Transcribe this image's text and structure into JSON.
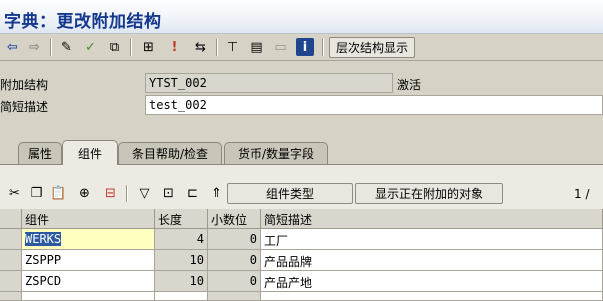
{
  "window": {
    "title": "字典：更改附加结构"
  },
  "toolbar": {
    "icons": [
      "back-arrow-icon",
      "forward-arrow-icon",
      "pencil-glasses-icon",
      "check-icon",
      "activate-icon",
      "where-used-icon",
      "info-exclaim-icon",
      "navigate-icon",
      "hierarchy-icon",
      "print-layout-icon",
      "empty-icon",
      "info-icon"
    ],
    "hierarchy_button": "层次结构显示"
  },
  "header": {
    "append_structure_label": "附加结构",
    "append_structure_value": "YTST_002",
    "status": "激活",
    "short_desc_label": "简短描述",
    "short_desc_value": "test_002"
  },
  "tabs": [
    "属性",
    "组件",
    "条目帮助/检查",
    "货币/数量字段"
  ],
  "grid_toolbar": {
    "component_type_button": "组件类型",
    "show_append_button": "显示正在附加的对象",
    "page_indicator": "1 /"
  },
  "table": {
    "columns": [
      "组件",
      "长度",
      "小数位",
      "简短描述"
    ],
    "rows": [
      {
        "component": "WERKS",
        "length": "4",
        "decimals": "0",
        "desc": "工厂"
      },
      {
        "component": "ZSPPP",
        "length": "10",
        "decimals": "0",
        "desc": "产品品牌"
      },
      {
        "component": "ZSPCD",
        "length": "10",
        "decimals": "0",
        "desc": "产品产地"
      }
    ]
  },
  "colors": {
    "title": "#14388c",
    "highlight": "#2c5aa0"
  }
}
